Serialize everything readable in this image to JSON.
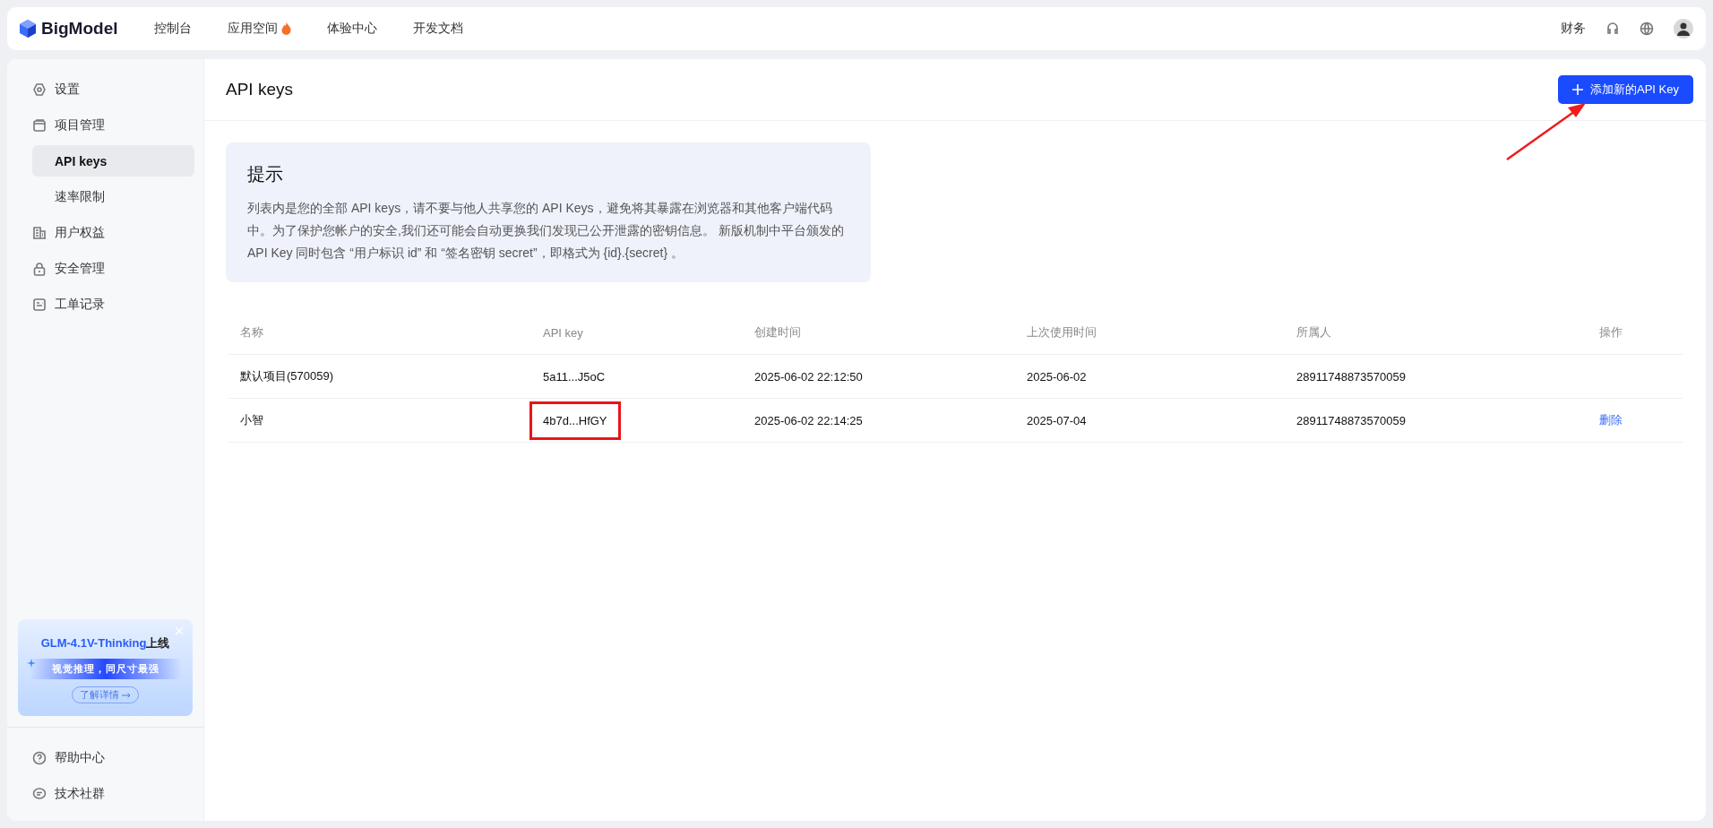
{
  "topbar": {
    "logo": "BigModel",
    "nav": [
      {
        "label": "控制台",
        "hot": false
      },
      {
        "label": "应用空间",
        "hot": true
      },
      {
        "label": "体验中心",
        "hot": false
      },
      {
        "label": "开发文档",
        "hot": false
      }
    ],
    "right_link": "财务"
  },
  "sidebar": {
    "items": [
      {
        "label": "设置",
        "kind": "settings",
        "selected": false
      },
      {
        "label": "项目管理",
        "kind": "window",
        "selected": false,
        "children": [
          {
            "label": "API keys",
            "selected": true
          },
          {
            "label": "速率限制",
            "selected": false
          }
        ]
      },
      {
        "label": "用户权益",
        "kind": "building",
        "selected": false
      },
      {
        "label": "安全管理",
        "kind": "lock",
        "selected": false
      },
      {
        "label": "工单记录",
        "kind": "ticket",
        "selected": false
      }
    ],
    "banner": {
      "title_highlight": "GLM-4.1V-Thinking",
      "title_rest": "上线",
      "subtitle": "视觉推理，同尺寸最强",
      "button": "了解详情"
    },
    "footer_items": [
      {
        "label": "帮助中心",
        "kind": "help"
      },
      {
        "label": "技术社群",
        "kind": "chat"
      }
    ]
  },
  "page": {
    "title": "API keys",
    "add_button": "添加新的API Key"
  },
  "notice": {
    "title": "提示",
    "text": "列表内是您的全部 API keys，请不要与他人共享您的 API Keys，避免将其暴露在浏览器和其他客户端代码中。为了保护您帐户的安全,我们还可能会自动更换我们发现已公开泄露的密钥信息。 新版机制中平台颁发的API Key 同时包含 “用户标识 id” 和 “签名密钥 secret”，即格式为 {id}.{secret} 。"
  },
  "table": {
    "columns": [
      "名称",
      "API key",
      "创建时间",
      "上次使用时间",
      "所属人",
      "操作"
    ],
    "rows": [
      {
        "name": "默认项目(570059)",
        "key": "5a11...J5oC",
        "created": "2025-06-02 22:12:50",
        "last_used": "2025-06-02",
        "owner": "28911748873570059",
        "highlighted": false
      },
      {
        "name": "小智",
        "key": "4b7d...HfGY",
        "created": "2025-06-02 22:14:25",
        "last_used": "2025-07-04",
        "owner": "28911748873570059",
        "action": "删除",
        "highlighted": true
      }
    ]
  },
  "annotations": [
    {
      "kind": "arrow"
    }
  ]
}
